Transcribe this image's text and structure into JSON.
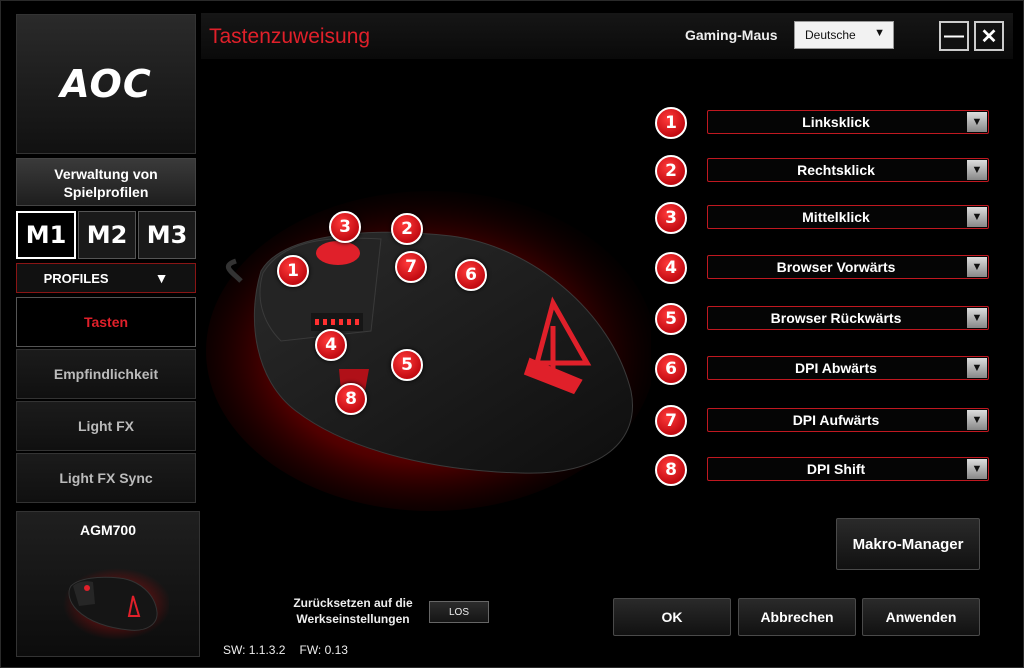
{
  "app": {
    "logo": "AOC",
    "title": "Tastenzuweisung",
    "device_label": "Gaming-Maus",
    "language": "Deutsche",
    "minimize_label": "—",
    "close_label": "✕"
  },
  "sidebar": {
    "profiles_title": "Verwaltung von Spielprofilen",
    "memory_tabs": [
      "M1",
      "M2",
      "M3"
    ],
    "active_tab": "M1",
    "profiles_dropdown": "PROFILES",
    "nav": [
      {
        "label": "Tasten",
        "active": true
      },
      {
        "label": "Empfindlichkeit",
        "active": false
      },
      {
        "label": "Light FX",
        "active": false
      },
      {
        "label": "Light FX Sync",
        "active": false
      }
    ],
    "device_name": "AGM700"
  },
  "mouse": {
    "brand_mark": "AGON",
    "callouts": [
      "1",
      "2",
      "3",
      "4",
      "5",
      "6",
      "7",
      "8"
    ]
  },
  "assignments": [
    {
      "num": "1",
      "action": "Linksklick"
    },
    {
      "num": "2",
      "action": "Rechtsklick"
    },
    {
      "num": "3",
      "action": "Mittelklick"
    },
    {
      "num": "4",
      "action": "Browser Vorwärts"
    },
    {
      "num": "5",
      "action": "Browser Rückwärts"
    },
    {
      "num": "6",
      "action": "DPI Abwärts"
    },
    {
      "num": "7",
      "action": "DPI Aufwärts"
    },
    {
      "num": "8",
      "action": "DPI Shift"
    }
  ],
  "buttons": {
    "macro_manager": "Makro-Manager",
    "ok": "OK",
    "cancel": "Abbrechen",
    "apply": "Anwenden",
    "reset_label": "Zurücksetzen auf die Werkseinstellungen",
    "reset_button": "LOS"
  },
  "footer": {
    "sw": "SW: 1.1.3.2",
    "fw": "FW: 0.13"
  },
  "colors": {
    "accent_red": "#e0202a",
    "badge_red": "#c30b12",
    "background": "#000000"
  }
}
